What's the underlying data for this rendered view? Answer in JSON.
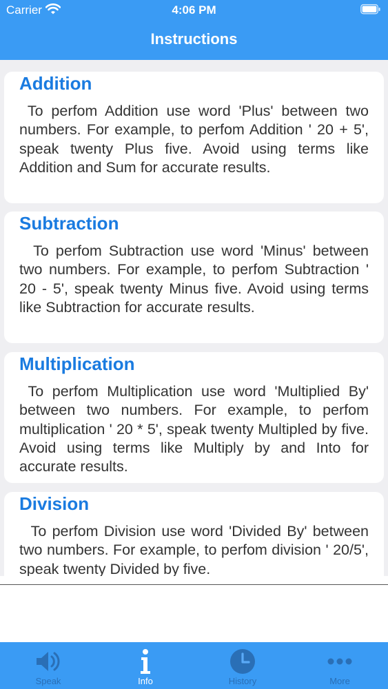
{
  "status_bar": {
    "carrier": "Carrier",
    "time": "4:06 PM"
  },
  "nav": {
    "title": "Instructions"
  },
  "cards": [
    {
      "title": "Addition",
      "body": " To perfom Addition use word 'Plus' between two numbers. For example, to perfom Addition ' 20 + 5', speak twenty Plus five. Avoid using terms like Addition and Sum for accurate results."
    },
    {
      "title": "Subtraction",
      "body": "  To perfom Subtraction use word 'Minus' between two numbers. For example, to perfom Subtraction ' 20 - 5', speak twenty Minus five. Avoid using terms like Subtraction for accurate results."
    },
    {
      "title": "Multiplication",
      "body": " To perfom Multiplication use word 'Multiplied By' between two numbers. For example, to perfom multiplication ' 20 * 5', speak twenty Multipled by five. Avoid using terms like Multiply by and Into for accurate results."
    },
    {
      "title": "Division",
      "body": "  To perfom Division use word 'Divided By' between two numbers. For example, to perfom division ' 20/5', speak twenty Divided by five."
    }
  ],
  "tabs": [
    {
      "label": "Speak",
      "icon": "speaker-icon",
      "active": false
    },
    {
      "label": "Info",
      "icon": "info-icon",
      "active": true
    },
    {
      "label": "History",
      "icon": "clock-icon",
      "active": false
    },
    {
      "label": "More",
      "icon": "more-dots-icon",
      "active": false
    }
  ],
  "colors": {
    "accent": "#3a9bf4",
    "title_blue": "#1a7be0",
    "background": "#efeff2",
    "inactive_tab": "#2a6fb6"
  }
}
